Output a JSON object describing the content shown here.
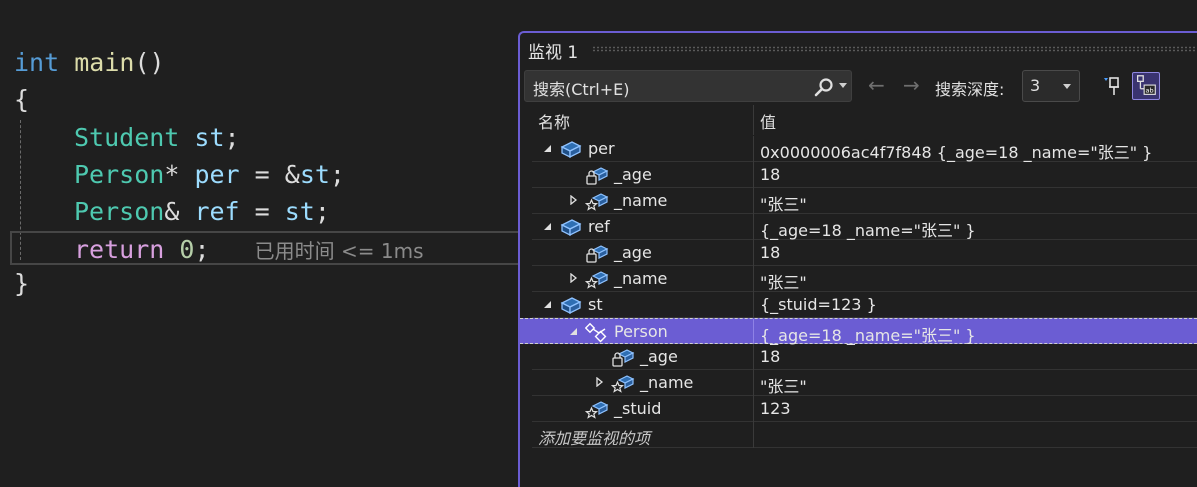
{
  "editor": {
    "kw_int": "int",
    "fn_main": "main",
    "parens": "()",
    "brace_open": "{",
    "brace_close": "}",
    "type_student": "Student",
    "var_st": "st",
    "semicolon": ";",
    "type_person": "Person",
    "ptr_op": "*",
    "ref_op": "&",
    "var_per": "per",
    "var_ref": "ref",
    "assign": " = ",
    "addr_op": "&",
    "kw_return": "return",
    "num_zero": "0",
    "elapsed": "已用时间 <= 1ms"
  },
  "watch": {
    "title": "监视 1",
    "search_placeholder": "搜索(Ctrl+E)",
    "nav_back": "←",
    "nav_forward": "→",
    "depth_label": "搜索深度:",
    "depth_value": "3",
    "columns": {
      "name": "名称",
      "value": "值"
    },
    "rows": [
      {
        "name": "per",
        "value": "0x0000006ac4f7f848 {_age=18 _name=\"张三\" }"
      },
      {
        "name": "_age",
        "value": "18"
      },
      {
        "name": "_name",
        "value": "\"张三\""
      },
      {
        "name": "ref",
        "value": "{_age=18 _name=\"张三\" }"
      },
      {
        "name": "_age",
        "value": "18"
      },
      {
        "name": "_name",
        "value": "\"张三\""
      },
      {
        "name": "st",
        "value": "{_stuid=123 }"
      },
      {
        "name": "Person",
        "value": "{_age=18 _name=\"张三\" }"
      },
      {
        "name": "_age",
        "value": "18"
      },
      {
        "name": "_name",
        "value": "\"张三\""
      },
      {
        "name": "_stuid",
        "value": "123"
      }
    ],
    "add_watch": "添加要监视的项"
  },
  "colors": {
    "accent": "#6b5dd3",
    "keyword": "#569cd6",
    "type": "#4ec9b0",
    "function": "#dcdcaa",
    "variable": "#9cdcfe",
    "number": "#b5cea8",
    "control": "#d8a0df"
  },
  "icons": {
    "object": "cube-object-icon",
    "private_field": "lock-field-icon",
    "protected_field": "star-field-icon",
    "base_class": "base-class-icon",
    "search": "search-icon",
    "pin": "pin-icon",
    "hex_display": "ab-display-icon"
  }
}
